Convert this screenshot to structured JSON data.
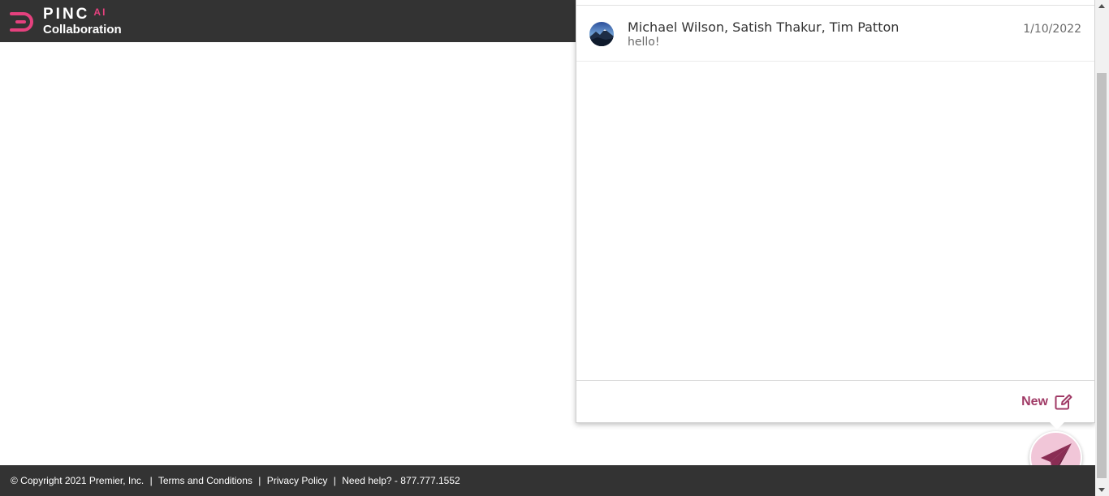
{
  "header": {
    "brand": "PINC",
    "brand_suffix": "AI",
    "product": "Collaboration",
    "brand_color": "#e5417e",
    "background": "#333333"
  },
  "conversations": [
    {
      "participants": "Michael Wilson, Satish Thakur, Tim Patton",
      "preview": "hello!",
      "date": "1/10/2022",
      "avatar_icon": "landscape-avatar"
    }
  ],
  "panel": {
    "new_label": "New",
    "new_icon": "edit-icon",
    "accent_color": "#a03a66"
  },
  "fab": {
    "icon": "paper-plane-icon",
    "background": "#f1c6d8"
  },
  "footer": {
    "copyright": "© Copyright 2021 Premier, Inc.",
    "terms": "Terms and Conditions",
    "privacy": "Privacy Policy",
    "help": "Need help? - 877.777.1552",
    "separator": "|"
  }
}
